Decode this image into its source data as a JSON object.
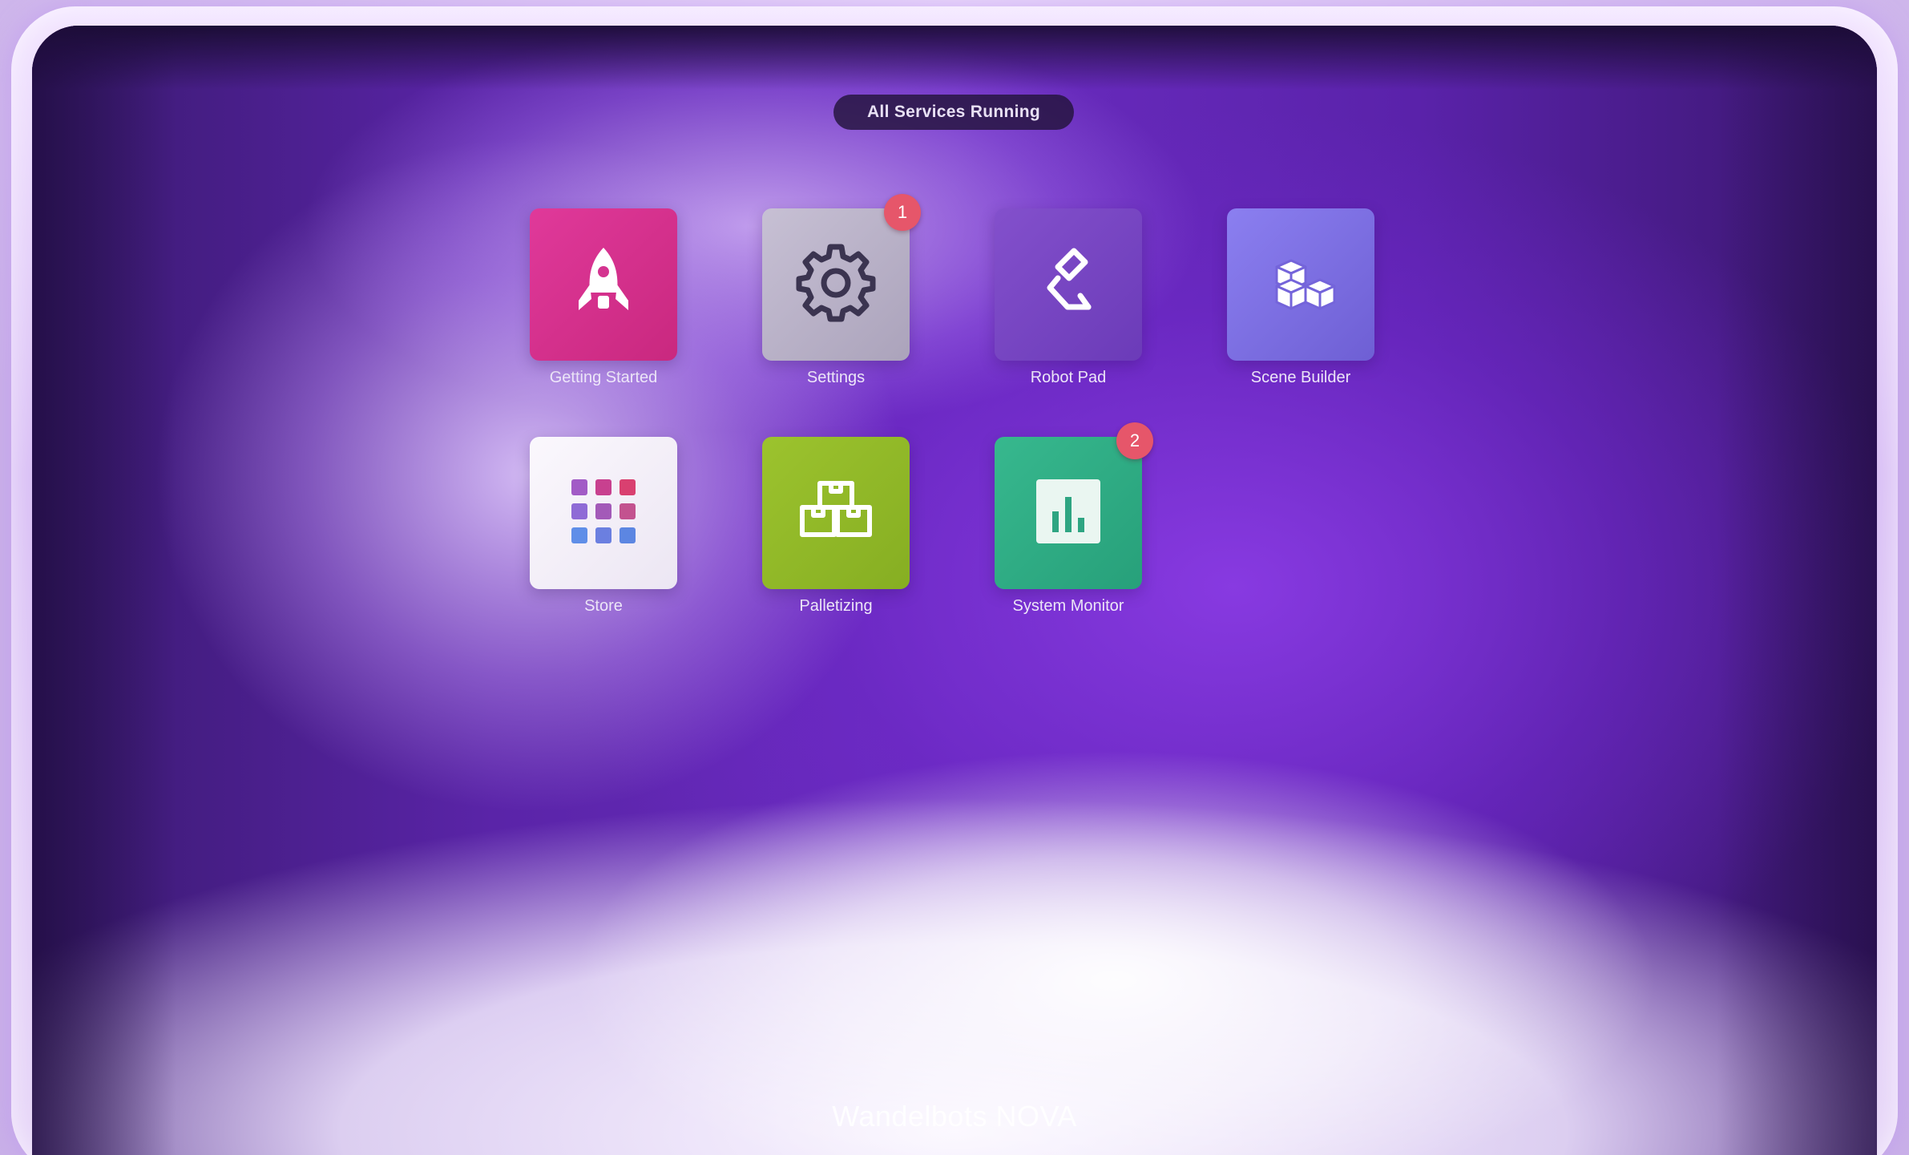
{
  "status": {
    "label": "All Services Running"
  },
  "apps": [
    {
      "label": "Getting Started",
      "icon": "rocket-icon",
      "color": "#d8338f",
      "badge": ""
    },
    {
      "label": "Settings",
      "icon": "gear-icon",
      "color": "#b9b2c8",
      "badge": "1"
    },
    {
      "label": "Robot Pad",
      "icon": "robot-arm-icon",
      "color": "#7a46c6",
      "badge": ""
    },
    {
      "label": "Scene Builder",
      "icon": "cubes-icon",
      "color": "#7e6fe0",
      "badge": ""
    },
    {
      "label": "Store",
      "icon": "app-grid-icon",
      "color": "#f3eef8",
      "badge": ""
    },
    {
      "label": "Palletizing",
      "icon": "pallet-boxes-icon",
      "color": "#8fb82a",
      "badge": ""
    },
    {
      "label": "System Monitor",
      "icon": "bar-chart-icon",
      "color": "#2fae86",
      "badge": "2"
    }
  ],
  "footer": {
    "brand": "Wandelbots NOVA"
  },
  "colors": {
    "badge": "#e6566a",
    "accent": "#6a2cc0"
  }
}
